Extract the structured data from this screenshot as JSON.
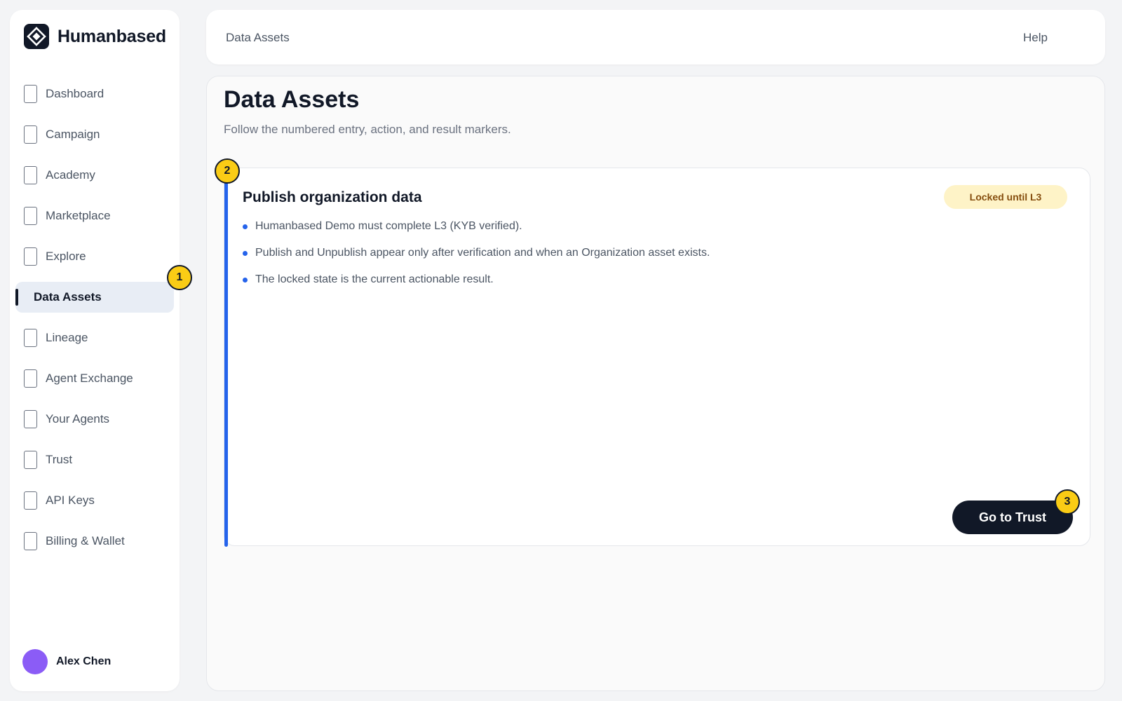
{
  "brand": {
    "name": "Humanbased",
    "logo_icon": "diamond-logo-icon"
  },
  "sidebar": {
    "items": [
      {
        "label": "Dashboard",
        "icon": "page-icon"
      },
      {
        "label": "Campaign",
        "icon": "page-icon"
      },
      {
        "label": "Academy",
        "icon": "page-icon"
      },
      {
        "label": "Marketplace",
        "icon": "page-icon"
      },
      {
        "label": "Explore",
        "icon": "page-icon"
      },
      {
        "label": "Data Assets",
        "icon": "page-icon",
        "active": true
      },
      {
        "label": "Lineage",
        "icon": "page-icon"
      },
      {
        "label": "Agent Exchange",
        "icon": "page-icon"
      },
      {
        "label": "Your Agents",
        "icon": "page-icon"
      },
      {
        "label": "Trust",
        "icon": "page-icon"
      },
      {
        "label": "API Keys",
        "icon": "page-icon"
      },
      {
        "label": "Billing & Wallet",
        "icon": "page-icon"
      }
    ],
    "user": {
      "name": "Alex Chen",
      "avatar_color": "#8b5cf6"
    }
  },
  "topbar": {
    "title": "Data Assets",
    "help_label": "Help"
  },
  "main": {
    "title": "Data Assets",
    "subtitle": "Follow the numbered entry, action, and result markers.",
    "card": {
      "title": "Publish organization data",
      "badge": "Locked until L3",
      "bullets": [
        "Humanbased Demo must complete L3 (KYB verified).",
        "Publish and Unpublish appear only after verification and when an Organization asset exists.",
        "The locked state is the current actionable result."
      ],
      "cta_label": "Go to Trust"
    }
  },
  "markers": {
    "entry": "1",
    "action": "2",
    "result": "3"
  },
  "colors": {
    "accent": "#2563eb",
    "marker": "#facc15",
    "badge_bg": "#fef3c7",
    "badge_text": "#854d0e",
    "primary_button": "#111827"
  }
}
